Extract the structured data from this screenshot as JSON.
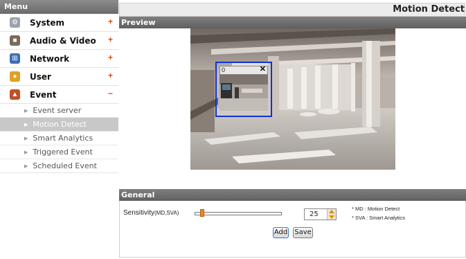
{
  "sidebar": {
    "header": "Menu",
    "items": [
      {
        "label": "System",
        "sign": "+",
        "icon": "system-icon"
      },
      {
        "label": "Audio & Video",
        "sign": "+",
        "icon": "audio-video-icon"
      },
      {
        "label": "Network",
        "sign": "+",
        "icon": "network-icon"
      },
      {
        "label": "User",
        "sign": "+",
        "icon": "user-icon"
      },
      {
        "label": "Event",
        "sign": "−",
        "icon": "event-icon"
      }
    ],
    "subitems": [
      {
        "label": "Event server",
        "active": false
      },
      {
        "label": "Motion Detect",
        "active": true
      },
      {
        "label": "Smart Analytics",
        "active": false
      },
      {
        "label": "Triggered Event",
        "active": false
      },
      {
        "label": "Scheduled Event",
        "active": false
      }
    ]
  },
  "page": {
    "title": "Motion Detect"
  },
  "preview": {
    "header": "Preview",
    "md_window": {
      "number": "0",
      "close": "✕"
    }
  },
  "general": {
    "header": "General",
    "sensitivity_label": "Sensitivity",
    "sensitivity_suffix": "(MD,SVA)",
    "sensitivity_value": "25",
    "note_md": "* MD : Motion Detect",
    "note_sva": "* SVA : Smart Analytics",
    "add_label": "Add",
    "save_label": "Save"
  }
}
